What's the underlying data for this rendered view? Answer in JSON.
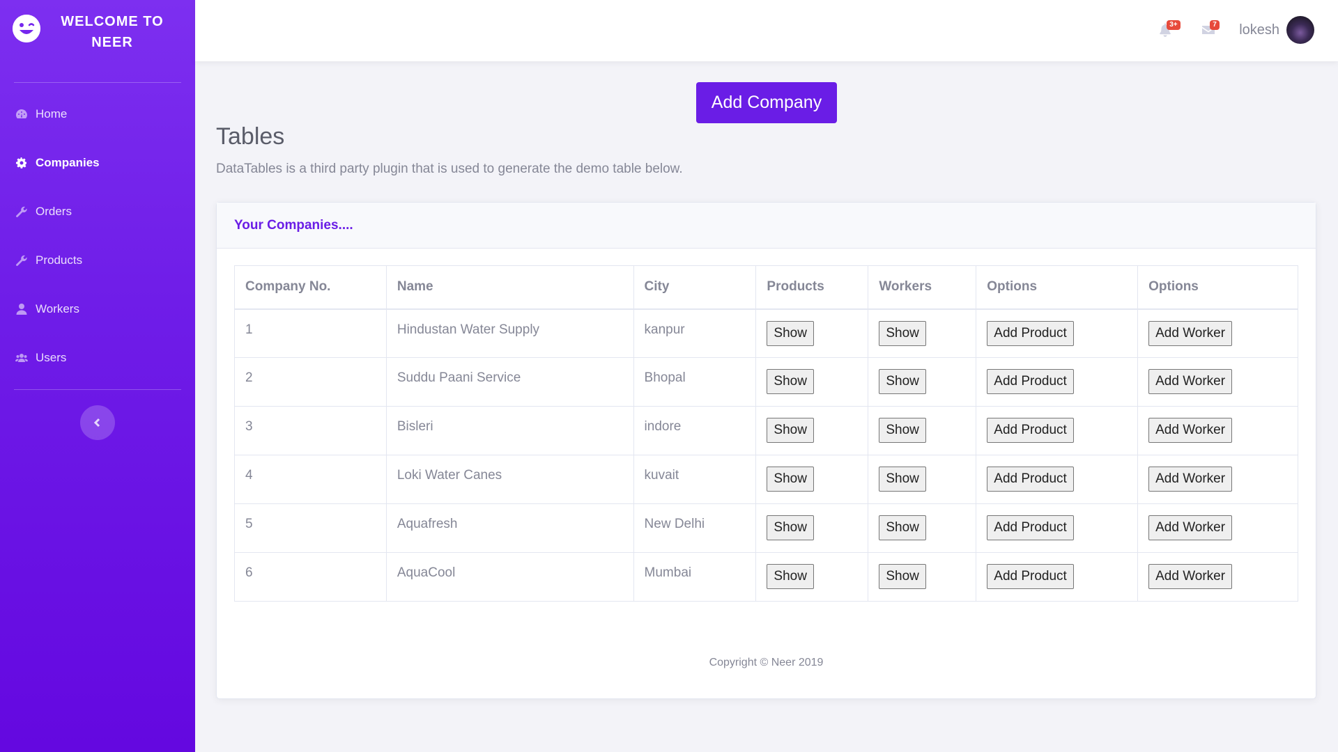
{
  "brand": {
    "title": "WELCOME TO NEER"
  },
  "sidebar": {
    "items": [
      {
        "label": "Home",
        "icon": "tachometer-icon"
      },
      {
        "label": "Companies",
        "icon": "cog-icon",
        "active": true
      },
      {
        "label": "Orders",
        "icon": "wrench-icon"
      },
      {
        "label": "Products",
        "icon": "wrench-icon"
      },
      {
        "label": "Workers",
        "icon": "user-icon"
      },
      {
        "label": "Users",
        "icon": "users-icon"
      }
    ]
  },
  "topbar": {
    "alerts_badge": "3+",
    "messages_badge": "7",
    "username": "lokesh"
  },
  "main": {
    "add_company_label": "Add Company",
    "title": "Tables",
    "description": "DataTables is a third party plugin that is used to generate the demo table below.",
    "card_title": "Your Companies....",
    "table": {
      "headers": [
        "Company No.",
        "Name",
        "City",
        "Products",
        "Workers",
        "Options",
        "Options"
      ],
      "rows": [
        {
          "no": "1",
          "name": "Hindustan Water Supply",
          "city": "kanpur"
        },
        {
          "no": "2",
          "name": "Suddu Paani Service",
          "city": "Bhopal"
        },
        {
          "no": "3",
          "name": "Bisleri",
          "city": "indore"
        },
        {
          "no": "4",
          "name": "Loki Water Canes",
          "city": "kuvait"
        },
        {
          "no": "5",
          "name": "Aquafresh",
          "city": "New Delhi"
        },
        {
          "no": "6",
          "name": "AquaCool",
          "city": "Mumbai"
        }
      ],
      "show_label": "Show",
      "add_product_label": "Add Product",
      "add_worker_label": "Add Worker"
    },
    "footer": "Copyright © Neer 2019"
  },
  "colors": {
    "primary": "#6a1de6",
    "sidebar_top": "#7d2ff0",
    "sidebar_bottom": "#6408e0",
    "badge": "#e74a3b"
  }
}
